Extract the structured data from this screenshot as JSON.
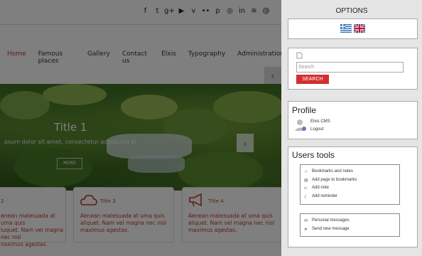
{
  "social_icons": [
    "facebook-icon",
    "twitter-icon",
    "google-plus-icon",
    "youtube-icon",
    "vimeo-icon",
    "flickr-icon",
    "pinterest-icon",
    "picasa-icon",
    "linkedin-icon",
    "rss-icon",
    "email-icon"
  ],
  "social_glyphs": [
    "f",
    "t",
    "g+",
    "▶",
    "v",
    "••",
    "p",
    "◎",
    "in",
    "≋",
    "@"
  ],
  "menu": [
    "Home",
    "Famous places",
    "Gallery",
    "Contact us",
    "Elxis",
    "Typography",
    "Administration"
  ],
  "slider": {
    "title": "Title 1",
    "caption": "psum dolor sit amet, consectetur adipiscing el",
    "more": "MORE",
    "next": "›",
    "prev": "‹"
  },
  "cards": [
    {
      "title": "2",
      "text": [
        "enean malesuada at uma quis",
        "luquet. Nam vel magna nec nisl",
        "naximus agestas."
      ]
    },
    {
      "title": "Title 3",
      "text": [
        "Aenean malesuada at uma quis",
        "aliquet. Nam vel magna nec nisl",
        "maximus agestas."
      ]
    },
    {
      "title": "Title 4",
      "text": [
        "Aenean malesuada at uma quis",
        "aliquet. Nam vel magna nec nisl",
        "maximus agestas."
      ]
    }
  ],
  "panel": {
    "title": "OPTIONS",
    "search": {
      "placeholder": "Search",
      "button": "SEARCH"
    },
    "profile": {
      "heading": "Profile",
      "name": "Elxis CMS",
      "logout": "Logout"
    },
    "users_tools": {
      "heading": "Users tools",
      "group1": [
        "Bookmarks and notes",
        "Add page to bookmarks",
        "Add note",
        "Add reminder"
      ],
      "group2": [
        "Personal messages",
        "Send new message"
      ]
    }
  },
  "colors": {
    "accent": "#c0392b",
    "panel_bg": "#e5e5e5",
    "search_button": "#d32f2f"
  }
}
